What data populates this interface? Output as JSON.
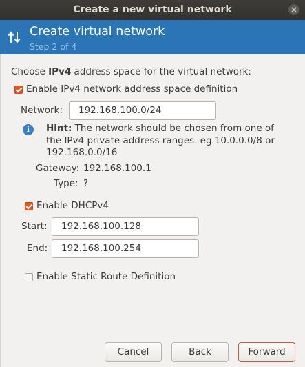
{
  "window": {
    "title": "Create a new virtual network"
  },
  "banner": {
    "title": "Create virtual network",
    "step": "Step 2 of 4",
    "icon": "updown-arrows-icon"
  },
  "ipv4": {
    "heading_prefix": "Choose ",
    "heading_bold": "IPv4",
    "heading_suffix": " address space for the virtual network:",
    "enable_label": "Enable IPv4 network address space definition",
    "enable_checked": true,
    "network_label": "Network:",
    "network_value": "192.168.100.0/24",
    "hint_bold": "Hint:",
    "hint_text": " The network should be chosen from one of the IPv4 private address ranges. eg 10.0.0.0/8 or 192.168.0.0/16",
    "gateway_label": "Gateway:",
    "gateway_value": "192.168.100.1",
    "type_label": "Type:",
    "type_value": "?"
  },
  "dhcp": {
    "enable_label": "Enable DHCPv4",
    "enable_checked": true,
    "start_label": "Start:",
    "start_value": "192.168.100.128",
    "end_label": "End:",
    "end_value": "192.168.100.254"
  },
  "static_route": {
    "enable_label": "Enable Static Route Definition",
    "enable_checked": false
  },
  "buttons": {
    "cancel": "Cancel",
    "back": "Back",
    "forward": "Forward"
  },
  "colors": {
    "banner": "#2b75b6",
    "accent": "#e95420",
    "titlebar": "#3e3d39"
  }
}
